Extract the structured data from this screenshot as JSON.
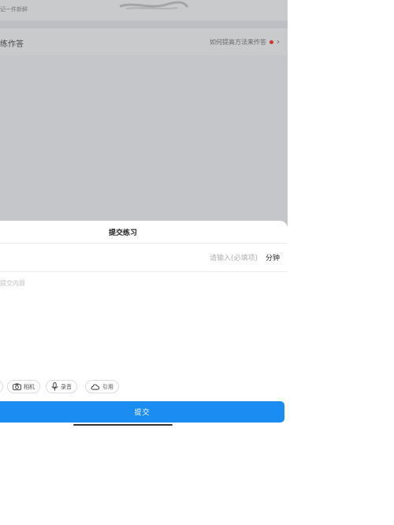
{
  "background": {
    "top_caption": "记一件新鲜"
  },
  "guide": {
    "left_label": "练作答",
    "right_label": "如何提高方法来作答",
    "dot_color": "#d03a32"
  },
  "sheet": {
    "title": "提交练习",
    "duration_placeholder": "请输入(必填项)",
    "duration_unit": "分钟",
    "content_placeholder": "提交内容",
    "tools": [
      {
        "label": "相机",
        "icon": "camera-icon"
      },
      {
        "label": "录音",
        "icon": "mic-icon"
      },
      {
        "label": "引用",
        "icon": "cloud-icon"
      }
    ],
    "submit_label": "提交",
    "accent": "#1a8cf2"
  }
}
